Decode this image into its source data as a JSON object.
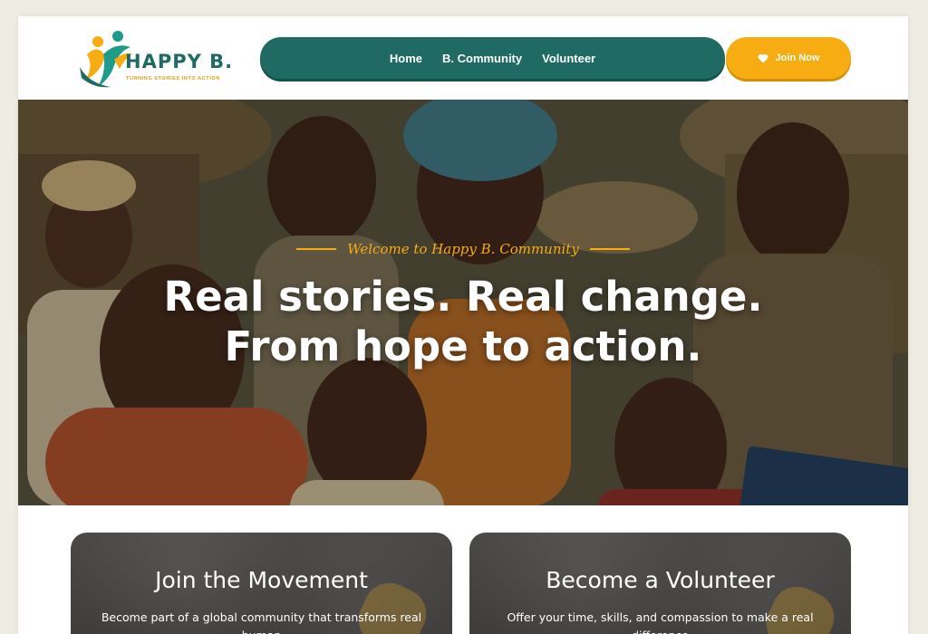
{
  "brand": {
    "name": "HAPPY B.",
    "tagline": "TURNING STORIES INTO ACTION",
    "primary_color": "#1f6b63",
    "accent_color": "#f7ac11"
  },
  "nav": {
    "items": [
      {
        "label": "Home"
      },
      {
        "label": "B. Community"
      },
      {
        "label": "Volunteer"
      }
    ],
    "cta_label": "Join Now",
    "cta_icon": "heart-icon"
  },
  "hero": {
    "welcome": "Welcome to Happy B. Community",
    "title_line1": "Real stories. Real change.",
    "title_line2": "From hope to action."
  },
  "cards": [
    {
      "title": "Join the Movement",
      "text": "Become part of a global community that transforms real human"
    },
    {
      "title": "Become a Volunteer",
      "text": "Offer your time, skills, and compassion to make a real difference"
    }
  ]
}
